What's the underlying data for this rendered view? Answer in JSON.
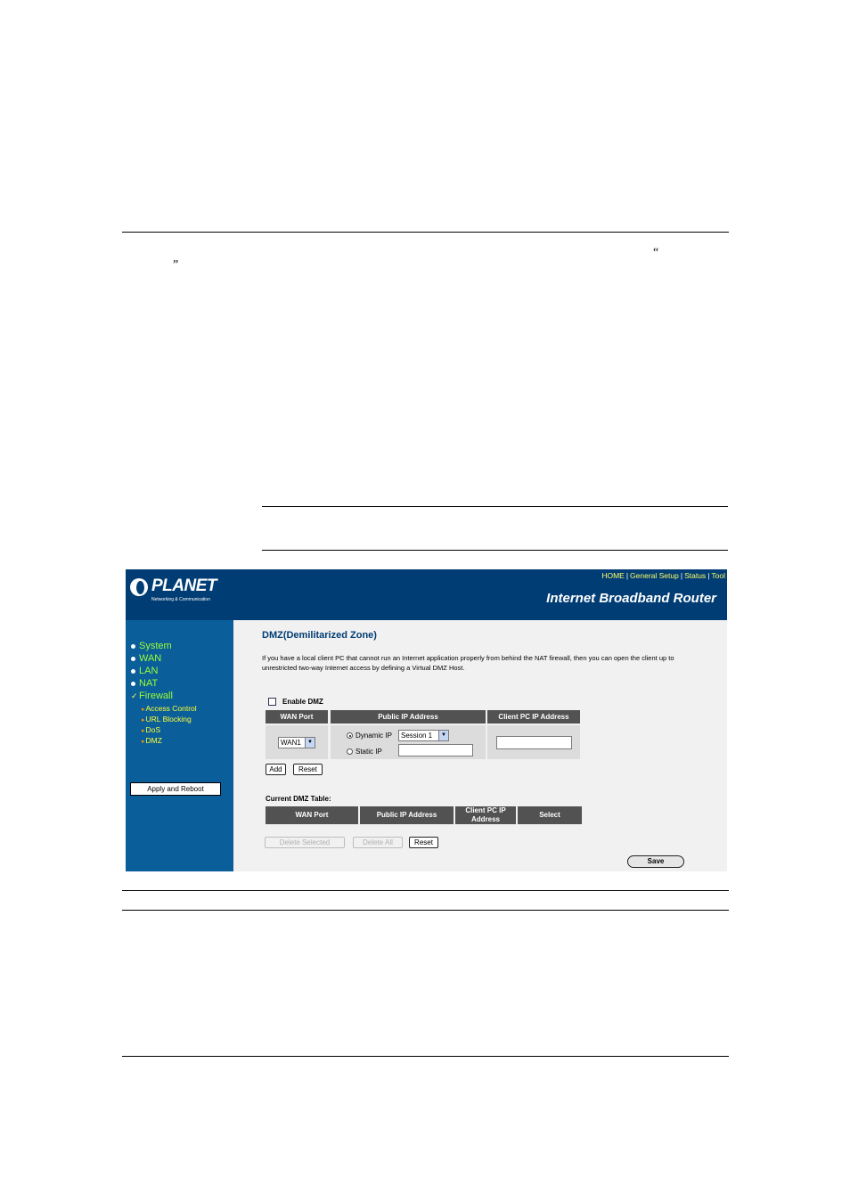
{
  "document": {
    "open_quote": "“",
    "close_quote": "”"
  },
  "screenshot": {
    "logo": {
      "word": "PLANET",
      "tagline": "Networking & Communication"
    },
    "top_nav": [
      "HOME",
      "General Setup",
      "Status",
      "Tool"
    ],
    "product_title": "Internet Broadband Router",
    "sidebar": {
      "menu": [
        "System",
        "WAN",
        "LAN",
        "NAT",
        "Firewall"
      ],
      "firewall_sub": [
        "Access Control",
        "URL Blocking",
        "DoS",
        "DMZ"
      ],
      "apply_button": "Apply and Reboot"
    },
    "main": {
      "title": "DMZ(Demilitarized Zone)",
      "description": "If you have a local client PC that cannot run an Internet application properly from behind the NAT firewall, then you can open the client up to unrestricted two-way Internet access by defining a Virtual DMZ Host.",
      "enable_label": "Enable DMZ",
      "enable_checked": false,
      "form_headers": [
        "WAN Port",
        "Public IP Address",
        "Client PC IP Address"
      ],
      "wan_port_value": "WAN1",
      "dynamic_ip_label": "Dynamic IP",
      "session_value": "Session 1",
      "static_ip_label": "Static IP",
      "static_ip_value": "",
      "client_ip_value": "",
      "add_button": "Add",
      "reset_button": "Reset",
      "table_title": "Current DMZ Table:",
      "table_headers": [
        "WAN Port",
        "Public IP Address",
        "Client PC IP Address",
        "Select"
      ],
      "delete_selected_button": "Delete Selected",
      "delete_all_button": "Delete All",
      "table_reset_button": "Reset",
      "save_button": "Save"
    }
  }
}
